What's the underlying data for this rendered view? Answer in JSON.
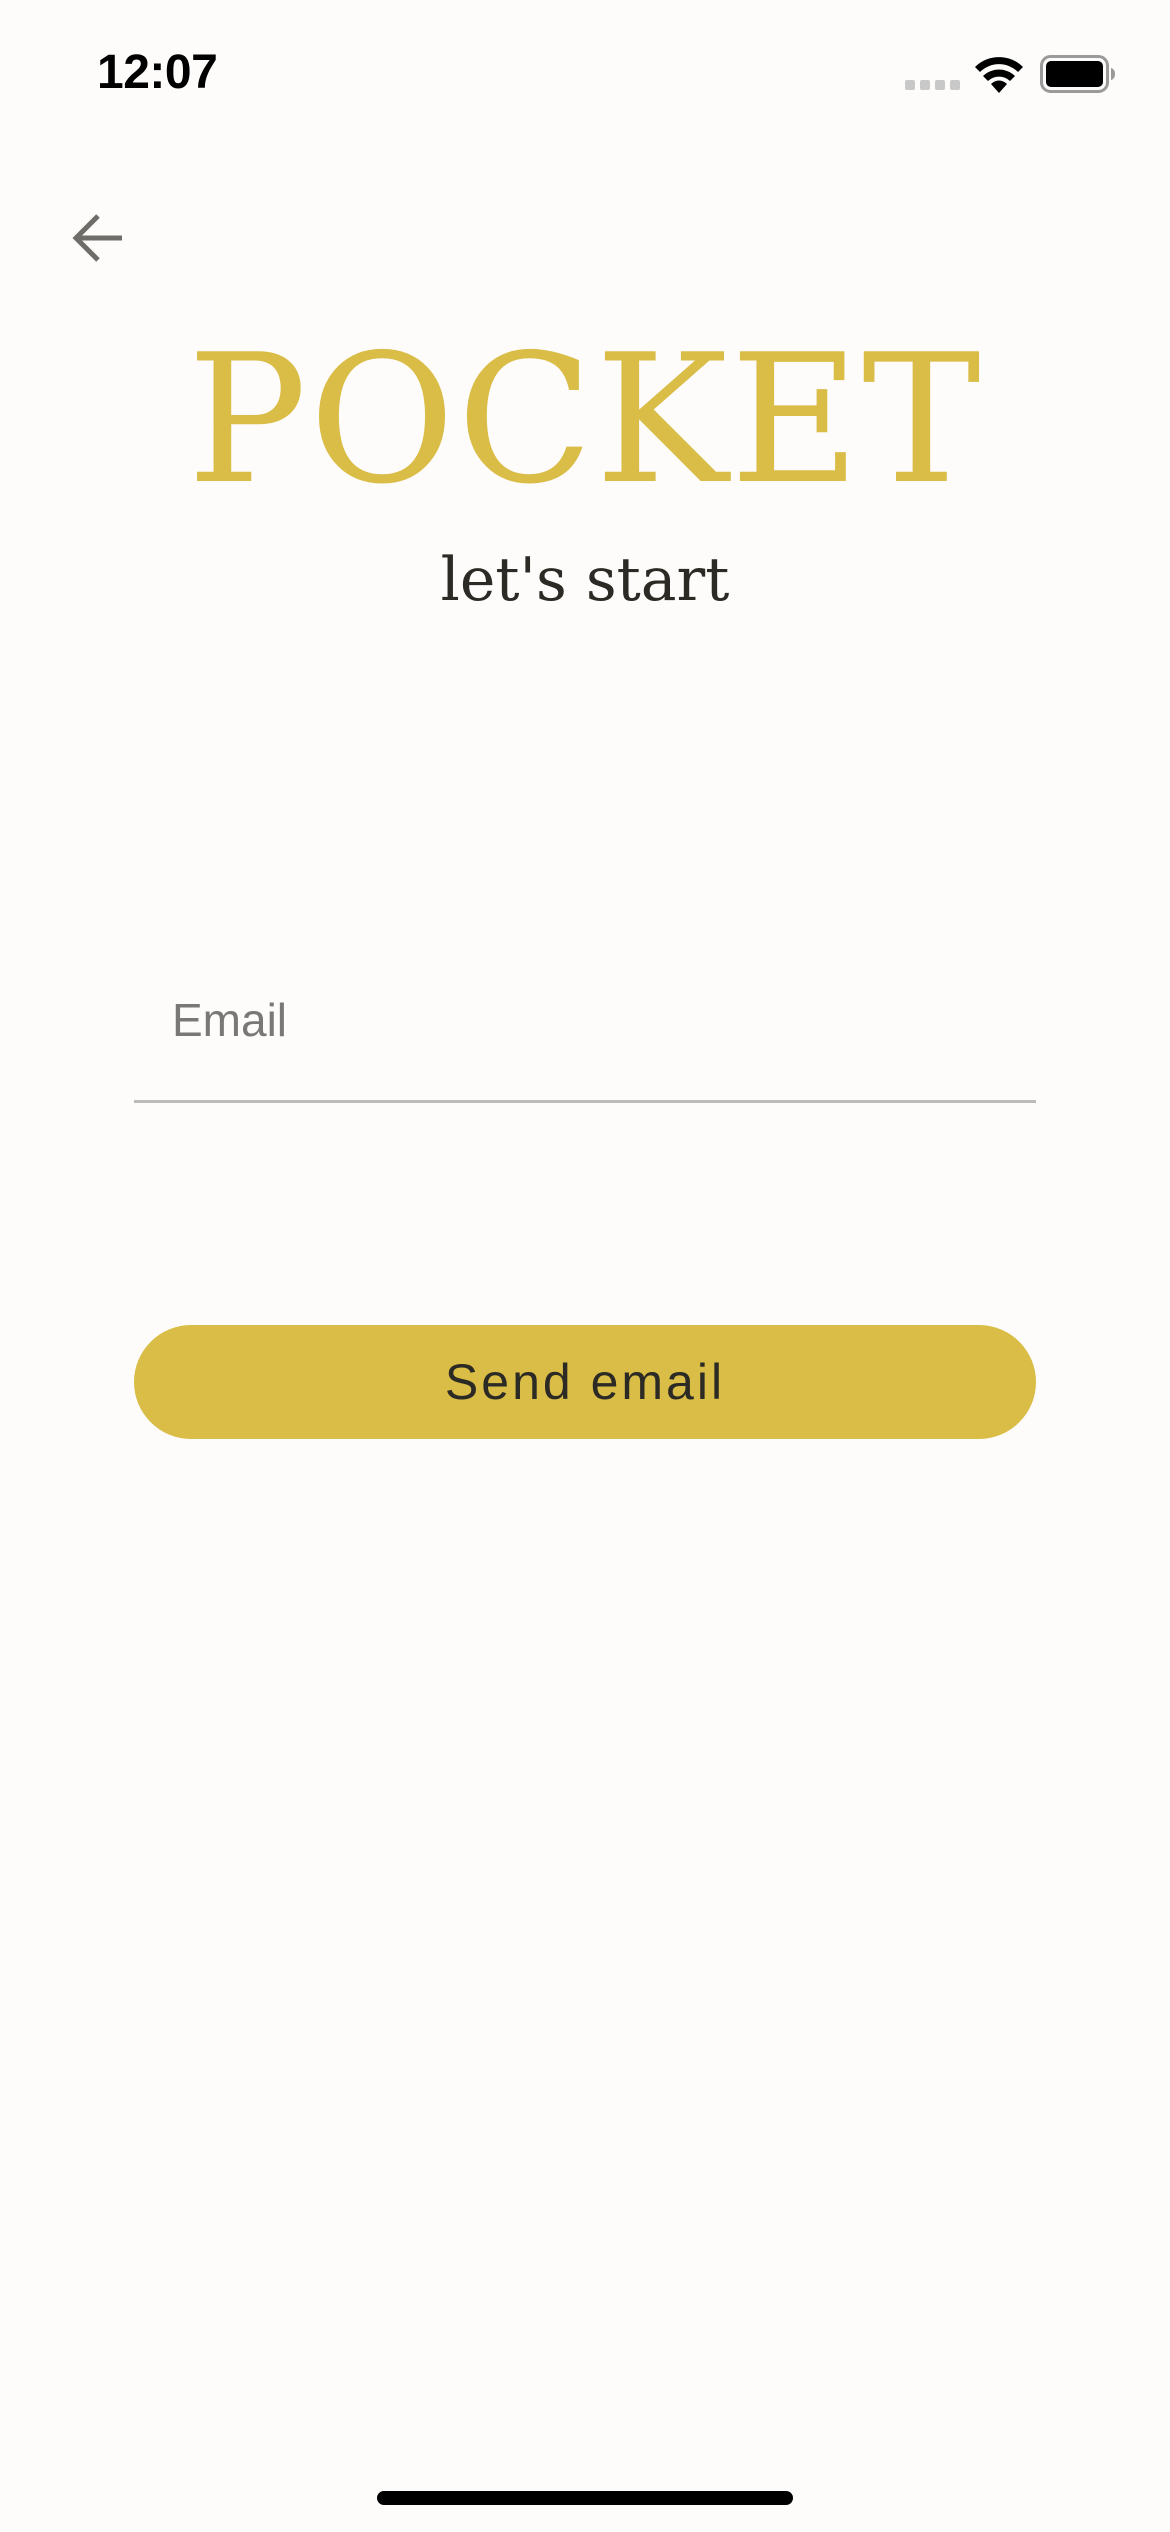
{
  "status_bar": {
    "time": "12:07",
    "icons": [
      "cellular-signal-icon",
      "wifi-icon",
      "battery-icon"
    ]
  },
  "navigation": {
    "back_icon": "arrow-left-icon"
  },
  "header": {
    "title": "POCKET",
    "subtitle": "let's start"
  },
  "form": {
    "email": {
      "value": "",
      "placeholder": "Email"
    },
    "submit_label": "Send email"
  },
  "colors": {
    "accent": "#d9bd47",
    "background": "#fefcfb",
    "text": "#2c2a24",
    "placeholder": "#7a7876",
    "divider": "#bdbbb8"
  }
}
